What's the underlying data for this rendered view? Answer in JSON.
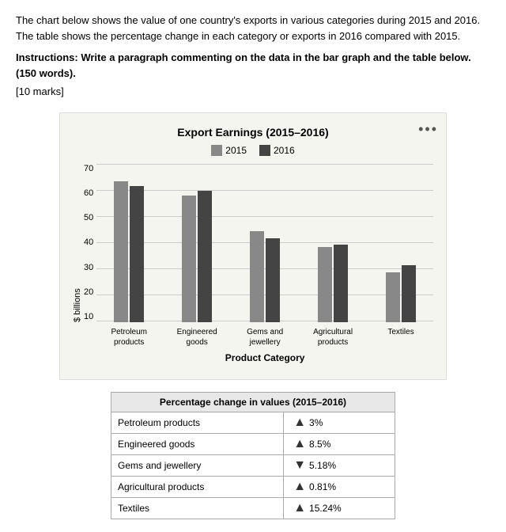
{
  "intro": {
    "description": "The chart below shows the value of one country's exports in various categories during 2015 and 2016. The table shows the percentage change in each category or exports in 2016 compared with 2015.",
    "instructions": "Instructions: Write a paragraph commenting on the data in the bar graph and the table below. (150 words).",
    "marks": "[10 marks]"
  },
  "chart": {
    "title": "Export Earnings (2015–2016)",
    "menu_icon": "•••",
    "legend": [
      {
        "label": "2015",
        "color": "#888"
      },
      {
        "label": "2016",
        "color": "#444"
      }
    ],
    "y_axis_label": "$ billions",
    "y_axis_values": [
      "70",
      "60",
      "50",
      "40",
      "30",
      "20",
      "10"
    ],
    "x_axis_title": "Product Category",
    "max_value": 70,
    "categories": [
      {
        "label": "Petroleum\nproducts",
        "label_line1": "Petroleum",
        "label_line2": "products",
        "val2015": 62,
        "val2016": 60
      },
      {
        "label": "Engineered\ngoods",
        "label_line1": "Engineered",
        "label_line2": "goods",
        "val2015": 56,
        "val2016": 58
      },
      {
        "label": "Gems and\njewellery",
        "label_line1": "Gems and",
        "label_line2": "jewellery",
        "val2015": 40,
        "val2016": 37
      },
      {
        "label": "Agricultural\nproducts",
        "label_line1": "Agricultural",
        "label_line2": "products",
        "val2015": 33,
        "val2016": 34
      },
      {
        "label": "Textiles",
        "label_line1": "Textiles",
        "label_line2": "",
        "val2015": 22,
        "val2016": 25
      }
    ]
  },
  "table": {
    "header": "Percentage change in values (2015–2016)",
    "rows": [
      {
        "category": "Petroleum products",
        "direction": "up",
        "value": "3%"
      },
      {
        "category": "Engineered goods",
        "direction": "up",
        "value": "8.5%"
      },
      {
        "category": "Gems and jewellery",
        "direction": "down",
        "value": "5.18%"
      },
      {
        "category": "Agricultural products",
        "direction": "up",
        "value": "0.81%"
      },
      {
        "category": "Textiles",
        "direction": "up",
        "value": "15.24%"
      }
    ]
  }
}
